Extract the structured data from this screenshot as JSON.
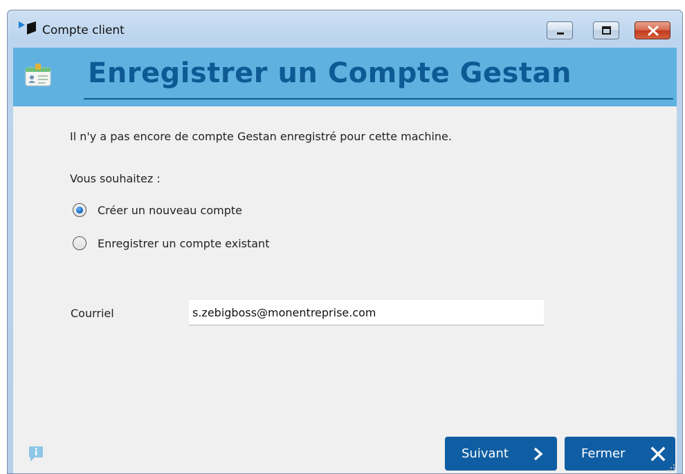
{
  "window": {
    "title": "Compte client",
    "icon": "app-logo-icon",
    "controls": [
      "minimize-icon",
      "maximize-icon",
      "close-icon"
    ]
  },
  "header": {
    "title": "Enregistrer un Compte Gestan",
    "icon": "id-card-icon",
    "band_color": "#5fb2e0",
    "title_color": "#0e5a95"
  },
  "body": {
    "intro": "Il n'y a pas encore de compte Gestan enregistré pour cette machine.",
    "question": "Vous souhaitez :",
    "options": [
      {
        "label": "Créer un nouveau compte",
        "checked": true
      },
      {
        "label": "Enregistrer un compte existant",
        "checked": false
      }
    ],
    "email": {
      "label": "Courriel",
      "value": "s.zebigboss@monentreprise.com"
    }
  },
  "footer": {
    "info_icon": "info-icon",
    "next_label": "Suivant",
    "next_icon": "chevron-right-icon",
    "close_label": "Fermer",
    "close_icon": "close-x-icon",
    "button_color": "#0f5ea3"
  }
}
